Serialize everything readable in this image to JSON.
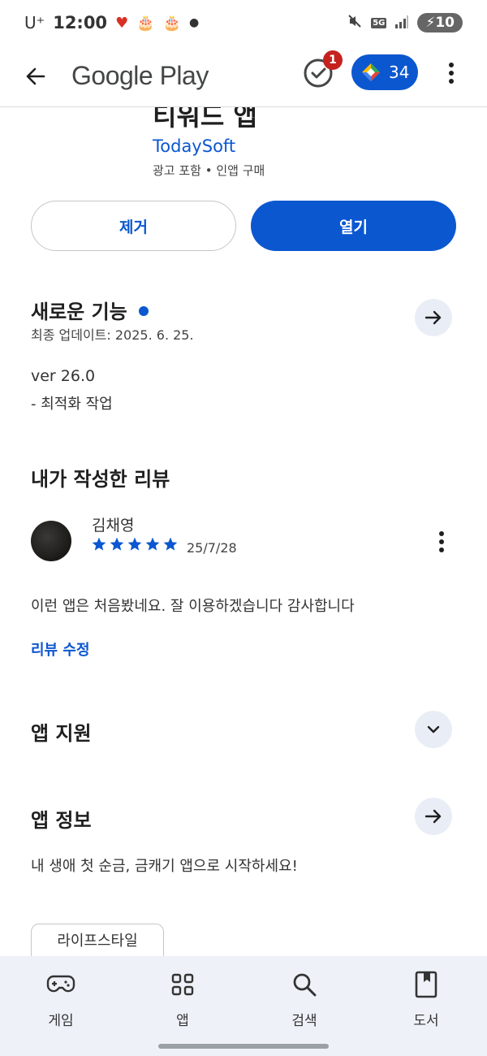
{
  "status_bar": {
    "carrier": "U⁺",
    "time": "12:00",
    "network": "5G",
    "battery": "10"
  },
  "header": {
    "title": "Google Play",
    "notification_count": "1",
    "points": "34"
  },
  "app": {
    "title_partial": "티워드 앱",
    "developer": "TodaySoft",
    "meta": "광고 포함 • 인앱 구매"
  },
  "actions": {
    "remove_label": "제거",
    "open_label": "열기"
  },
  "whats_new": {
    "title": "새로운 기능",
    "updated": "최종 업데이트: 2025. 6. 25.",
    "version": "ver 26.0",
    "notes": "- 최적화 작업"
  },
  "my_review": {
    "title": "내가 작성한 리뷰",
    "reviewer": "김채영",
    "rating": 5,
    "date": "25/7/28",
    "text": "이런 앱은 처음봤네요. 잘 이용하겠습니다 감사합니다",
    "edit_label": "리뷰 수정"
  },
  "app_support": {
    "title": "앱 지원"
  },
  "about": {
    "title": "앱 정보",
    "description": "내 생애 첫 순금, 금캐기 앱으로 시작하세요!",
    "tag": "라이프스타일"
  },
  "bottom_nav": [
    {
      "label": "게임",
      "icon": "gamepad-icon"
    },
    {
      "label": "앱",
      "icon": "apps-grid-icon"
    },
    {
      "label": "검색",
      "icon": "search-icon"
    },
    {
      "label": "도서",
      "icon": "book-icon"
    }
  ],
  "colors": {
    "accent": "#0b57d0",
    "badge": "#c5221f",
    "nav_bg": "#eef2f8"
  }
}
